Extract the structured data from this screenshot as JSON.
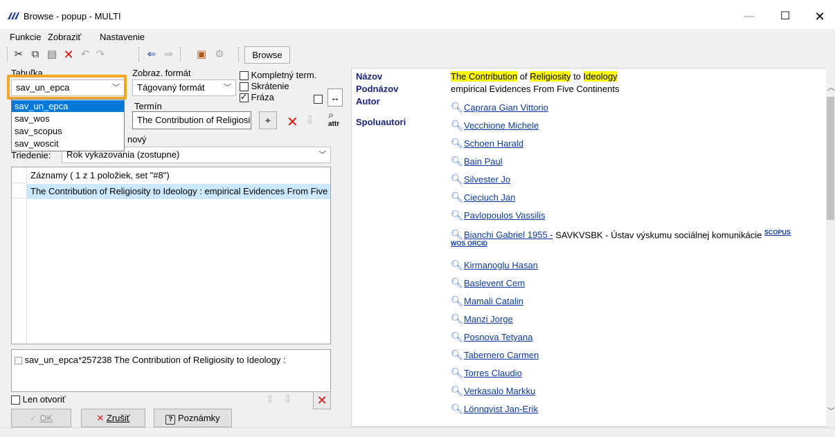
{
  "window": {
    "title": "Browse - popup - MULTI",
    "min_glyph": "—",
    "max_glyph": "☐",
    "close_glyph": "✕"
  },
  "menu": [
    "Funkcie",
    "Zobraziť",
    "Nastavenie"
  ],
  "toolbar": {
    "browse_label": "Browse",
    "icons": [
      "scissors-icon",
      "copy-icon",
      "paste-icon",
      "delete-icon",
      "undo-icon",
      "redo-icon",
      "back-icon",
      "forward-icon",
      "package-icon",
      "settings-icon"
    ]
  },
  "left": {
    "table_label": "Tabuľka",
    "table_value": "sav_un_epca",
    "table_options": [
      "sav_un_epca",
      "sav_wos",
      "sav_scopus",
      "sav_woscit"
    ],
    "format_label": "Zobraz. formát",
    "format_value": "Tágovaný formát",
    "check_complete": "Kompletný term.",
    "check_abbrev": "Skrátenie",
    "check_phrase": "Fráza",
    "term_label": "Termín",
    "term_value": "The Contribution of Religiosity to Ideology",
    "attr_label": "attr",
    "new_label": "nový",
    "sort_label": "Triedenie:",
    "sort_value": "Rok vykazovania (zostupne)",
    "records_header": "Záznamy ( 1 z 1  položiek, set \"#8\")",
    "record_row": "The Contribution of Religiosity to Ideology : empirical Evidences From Five Continents",
    "selected_entry": "sav_un_epca*257238  The Contribution of Religiosity to Ideology :",
    "open_only": "Len otvoriť",
    "ok_label": "OK",
    "cancel_label": "Zrušiť",
    "notes_label": "Poznámky"
  },
  "record": {
    "title_label": "Názov",
    "subtitle_label": "Podnázov",
    "author_label": "Autor",
    "coauthors_label": "Spoluautori",
    "title_parts": [
      "The Contribution",
      " of ",
      "Religiosity",
      " to ",
      "Ideology"
    ],
    "subtitle": "empirical Evidences From Five Continents",
    "author": "Caprara Gian Vittorio",
    "coauthors": [
      "Vecchione Michele",
      "Schoen Harald",
      "Bain Paul",
      "Silvester Jo",
      "Cieciuch Jan",
      "Pavlopoulos Vassilis"
    ],
    "bianchi_name": "Bianchi Gabriel 1955 -",
    "bianchi_affil": "SAVKVSBK - Ústav výskumu sociálnej komunikácie",
    "bianchi_tags": [
      "SCOPUS",
      "WOS",
      "ORCID"
    ],
    "coauthors_after": [
      "Kirmanoglu Hasan",
      "Baslevent Cem",
      "Mamali Catalin",
      "Manzi Jorge",
      "Posnova Tetyana",
      "Tabernero Carmen",
      "Torres Claudio",
      "Verkasalo Markku",
      "Lönnqvist Jan-Erik"
    ]
  }
}
